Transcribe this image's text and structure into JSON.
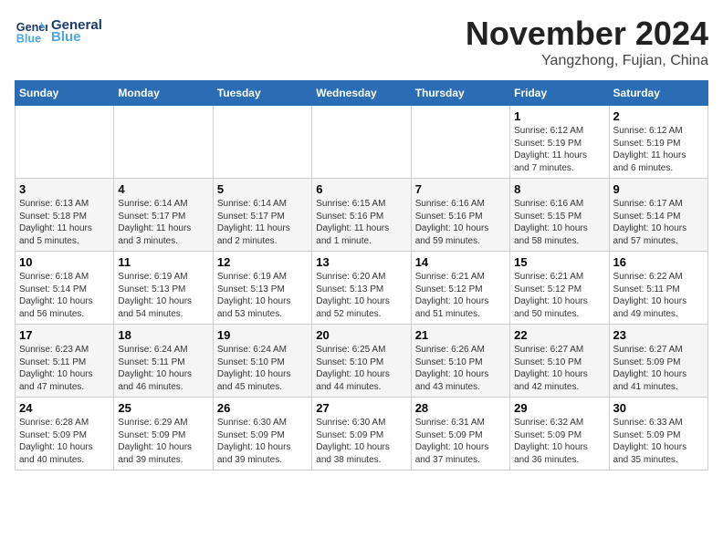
{
  "logo": {
    "text_general": "General",
    "text_blue": "Blue"
  },
  "title": "November 2024",
  "location": "Yangzhong, Fujian, China",
  "days_of_week": [
    "Sunday",
    "Monday",
    "Tuesday",
    "Wednesday",
    "Thursday",
    "Friday",
    "Saturday"
  ],
  "weeks": [
    [
      {
        "day": "",
        "info": ""
      },
      {
        "day": "",
        "info": ""
      },
      {
        "day": "",
        "info": ""
      },
      {
        "day": "",
        "info": ""
      },
      {
        "day": "",
        "info": ""
      },
      {
        "day": "1",
        "info": "Sunrise: 6:12 AM\nSunset: 5:19 PM\nDaylight: 11 hours\nand 7 minutes."
      },
      {
        "day": "2",
        "info": "Sunrise: 6:12 AM\nSunset: 5:19 PM\nDaylight: 11 hours\nand 6 minutes."
      }
    ],
    [
      {
        "day": "3",
        "info": "Sunrise: 6:13 AM\nSunset: 5:18 PM\nDaylight: 11 hours\nand 5 minutes."
      },
      {
        "day": "4",
        "info": "Sunrise: 6:14 AM\nSunset: 5:17 PM\nDaylight: 11 hours\nand 3 minutes."
      },
      {
        "day": "5",
        "info": "Sunrise: 6:14 AM\nSunset: 5:17 PM\nDaylight: 11 hours\nand 2 minutes."
      },
      {
        "day": "6",
        "info": "Sunrise: 6:15 AM\nSunset: 5:16 PM\nDaylight: 11 hours\nand 1 minute."
      },
      {
        "day": "7",
        "info": "Sunrise: 6:16 AM\nSunset: 5:16 PM\nDaylight: 10 hours\nand 59 minutes."
      },
      {
        "day": "8",
        "info": "Sunrise: 6:16 AM\nSunset: 5:15 PM\nDaylight: 10 hours\nand 58 minutes."
      },
      {
        "day": "9",
        "info": "Sunrise: 6:17 AM\nSunset: 5:14 PM\nDaylight: 10 hours\nand 57 minutes."
      }
    ],
    [
      {
        "day": "10",
        "info": "Sunrise: 6:18 AM\nSunset: 5:14 PM\nDaylight: 10 hours\nand 56 minutes."
      },
      {
        "day": "11",
        "info": "Sunrise: 6:19 AM\nSunset: 5:13 PM\nDaylight: 10 hours\nand 54 minutes."
      },
      {
        "day": "12",
        "info": "Sunrise: 6:19 AM\nSunset: 5:13 PM\nDaylight: 10 hours\nand 53 minutes."
      },
      {
        "day": "13",
        "info": "Sunrise: 6:20 AM\nSunset: 5:13 PM\nDaylight: 10 hours\nand 52 minutes."
      },
      {
        "day": "14",
        "info": "Sunrise: 6:21 AM\nSunset: 5:12 PM\nDaylight: 10 hours\nand 51 minutes."
      },
      {
        "day": "15",
        "info": "Sunrise: 6:21 AM\nSunset: 5:12 PM\nDaylight: 10 hours\nand 50 minutes."
      },
      {
        "day": "16",
        "info": "Sunrise: 6:22 AM\nSunset: 5:11 PM\nDaylight: 10 hours\nand 49 minutes."
      }
    ],
    [
      {
        "day": "17",
        "info": "Sunrise: 6:23 AM\nSunset: 5:11 PM\nDaylight: 10 hours\nand 47 minutes."
      },
      {
        "day": "18",
        "info": "Sunrise: 6:24 AM\nSunset: 5:11 PM\nDaylight: 10 hours\nand 46 minutes."
      },
      {
        "day": "19",
        "info": "Sunrise: 6:24 AM\nSunset: 5:10 PM\nDaylight: 10 hours\nand 45 minutes."
      },
      {
        "day": "20",
        "info": "Sunrise: 6:25 AM\nSunset: 5:10 PM\nDaylight: 10 hours\nand 44 minutes."
      },
      {
        "day": "21",
        "info": "Sunrise: 6:26 AM\nSunset: 5:10 PM\nDaylight: 10 hours\nand 43 minutes."
      },
      {
        "day": "22",
        "info": "Sunrise: 6:27 AM\nSunset: 5:10 PM\nDaylight: 10 hours\nand 42 minutes."
      },
      {
        "day": "23",
        "info": "Sunrise: 6:27 AM\nSunset: 5:09 PM\nDaylight: 10 hours\nand 41 minutes."
      }
    ],
    [
      {
        "day": "24",
        "info": "Sunrise: 6:28 AM\nSunset: 5:09 PM\nDaylight: 10 hours\nand 40 minutes."
      },
      {
        "day": "25",
        "info": "Sunrise: 6:29 AM\nSunset: 5:09 PM\nDaylight: 10 hours\nand 39 minutes."
      },
      {
        "day": "26",
        "info": "Sunrise: 6:30 AM\nSunset: 5:09 PM\nDaylight: 10 hours\nand 39 minutes."
      },
      {
        "day": "27",
        "info": "Sunrise: 6:30 AM\nSunset: 5:09 PM\nDaylight: 10 hours\nand 38 minutes."
      },
      {
        "day": "28",
        "info": "Sunrise: 6:31 AM\nSunset: 5:09 PM\nDaylight: 10 hours\nand 37 minutes."
      },
      {
        "day": "29",
        "info": "Sunrise: 6:32 AM\nSunset: 5:09 PM\nDaylight: 10 hours\nand 36 minutes."
      },
      {
        "day": "30",
        "info": "Sunrise: 6:33 AM\nSunset: 5:09 PM\nDaylight: 10 hours\nand 35 minutes."
      }
    ]
  ]
}
